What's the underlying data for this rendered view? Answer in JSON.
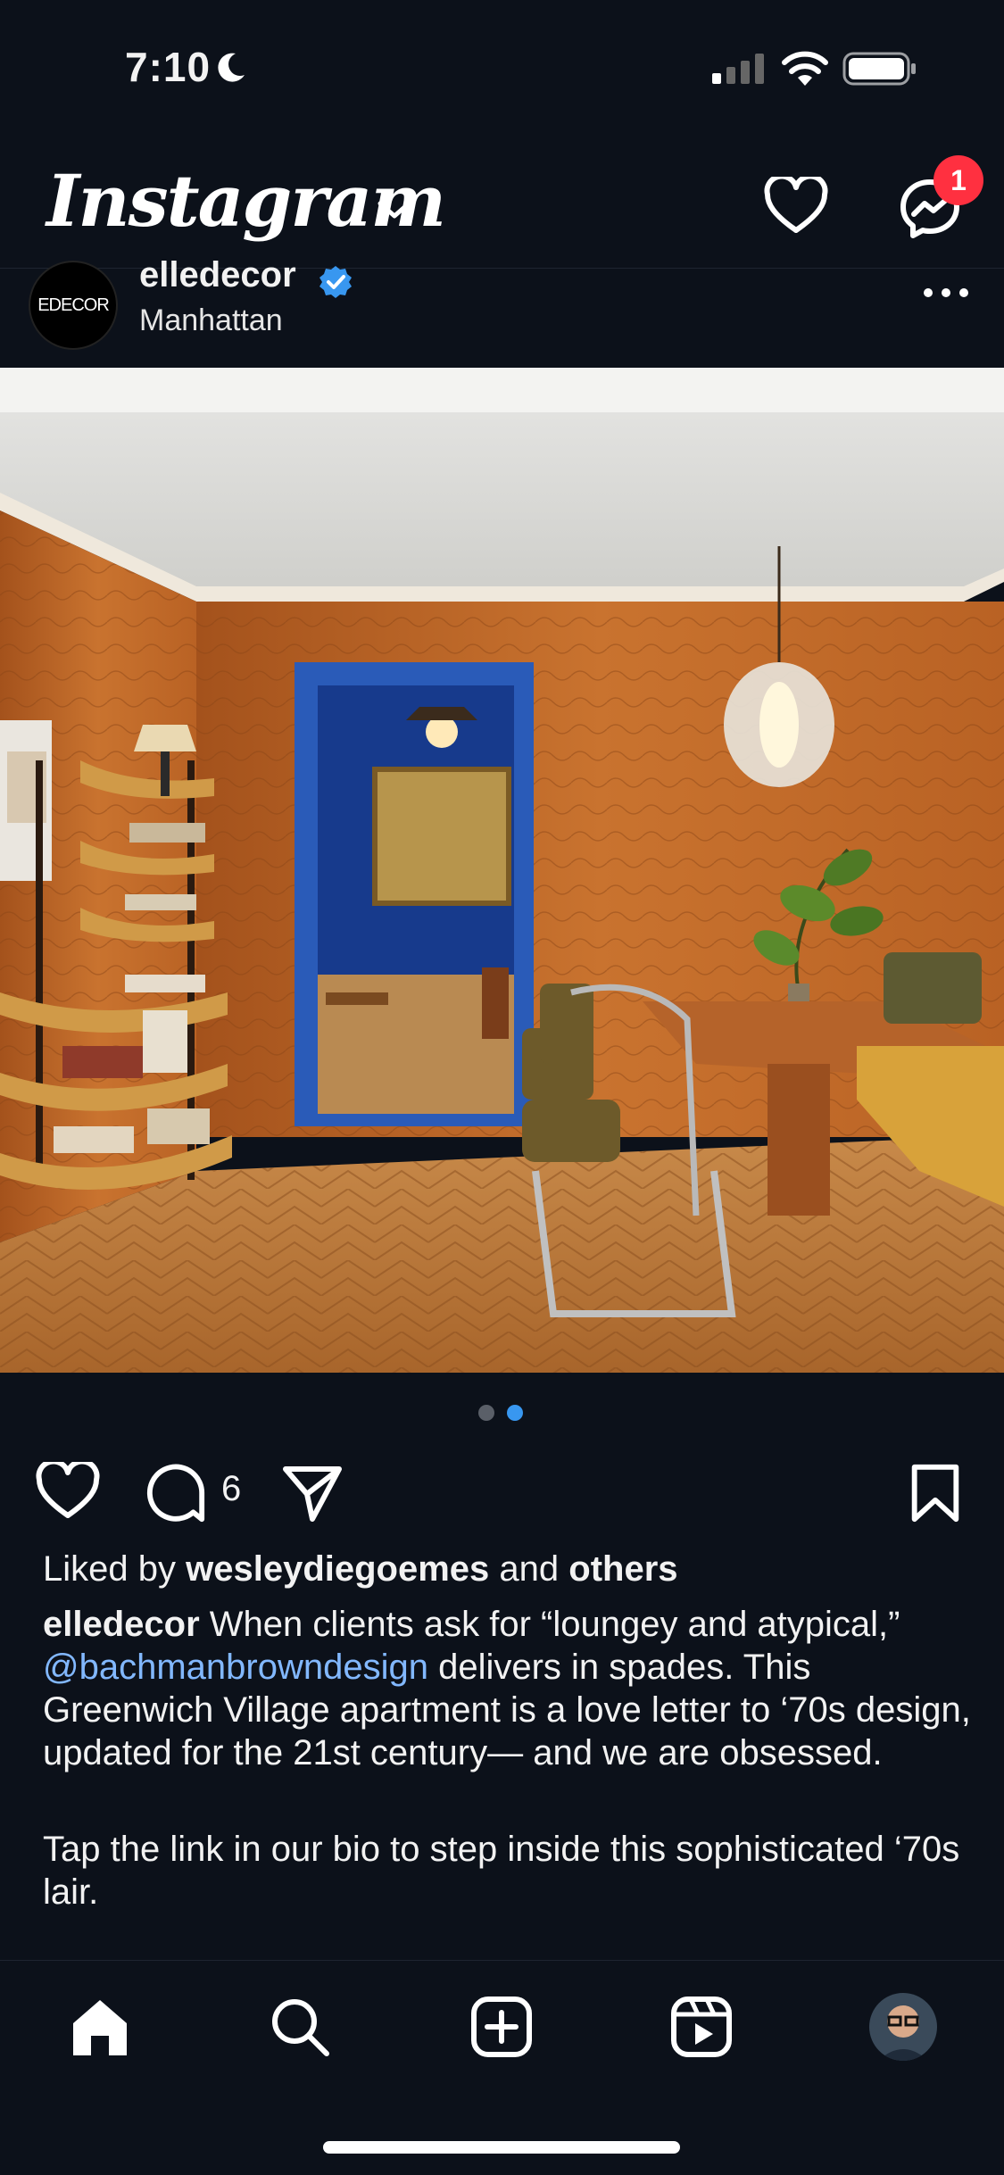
{
  "status_bar": {
    "time": "7:10"
  },
  "header": {
    "logo_text": "Instagram",
    "notification_count": "1"
  },
  "post": {
    "brand_avatar_text": "EDECOR",
    "username": "elledecor",
    "location": "Manhattan",
    "comment_count": "6",
    "carousel": {
      "total": 2,
      "active_index": 1
    },
    "liked_by": {
      "prefix": "Liked by ",
      "user": "wesleydiegoemes",
      "and": " and ",
      "others": "others"
    },
    "caption": {
      "username": "elledecor",
      "text_1": " When clients ask for “loungey and atypical,” ",
      "mention": "@bachmanbrowndesign",
      "text_2": " delivers in spades. This Greenwich Village apartment is a love letter to ‘70s design, updated for the 21st century— and we are obsessed.",
      "paragraph_2": "Tap the link in our bio to step inside this sophisticated ‘70s lair."
    }
  },
  "colors": {
    "background": "#0c111a",
    "accent_blue": "#3897f0",
    "badge_red": "#ff3040",
    "mention_blue": "#82b8ff"
  }
}
